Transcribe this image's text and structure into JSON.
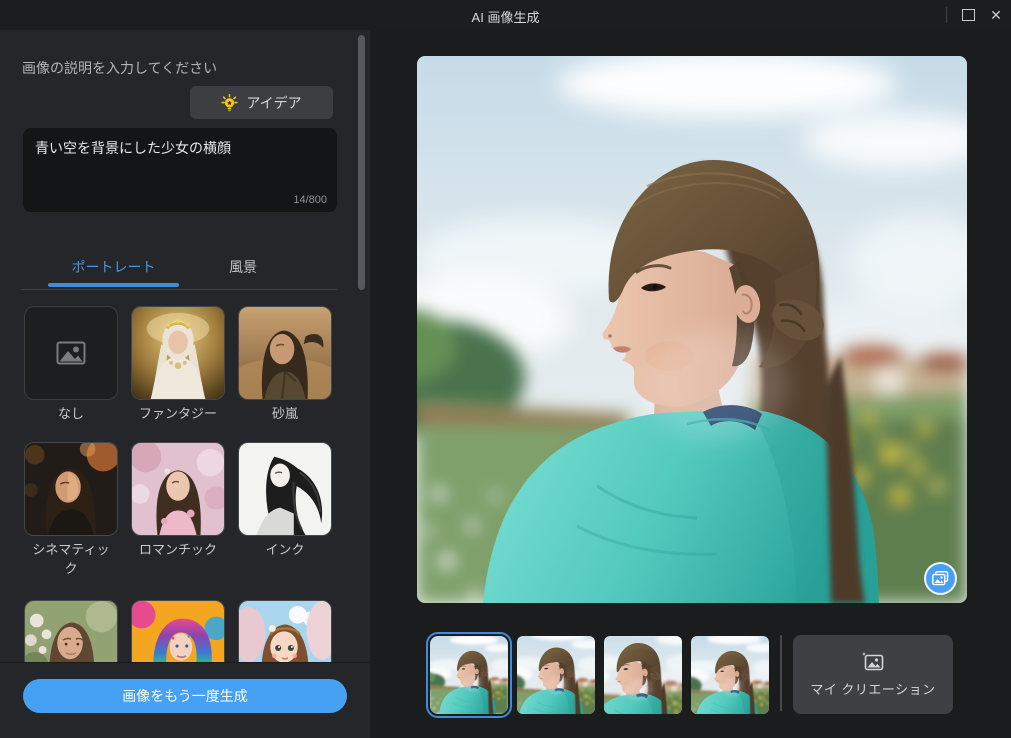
{
  "window": {
    "title": "AI 画像生成",
    "close_glyph": "✕"
  },
  "prompt": {
    "label": "画像の説明を入力してください",
    "idea_button_label": "アイデア",
    "value": "青い空を背景にした少女の横顔",
    "char_counter": "14/800"
  },
  "tabs": {
    "portrait": "ポートレート",
    "landscape": "風景",
    "active_tab": "portrait"
  },
  "styles": [
    {
      "label": "なし"
    },
    {
      "label": "ファンタジー"
    },
    {
      "label": "砂嵐"
    },
    {
      "label": "シネマティック"
    },
    {
      "label": "ロマンチック"
    },
    {
      "label": "インク"
    },
    {
      "label": ""
    },
    {
      "label": ""
    },
    {
      "label": ""
    }
  ],
  "generate_button_label": "画像をもう一度生成",
  "results": {
    "count": 4,
    "selected_index": 0,
    "my_creations_label": "マイ クリエーション"
  },
  "icons": {
    "idea": "lightbulb-icon",
    "none_style": "image-placeholder-icon",
    "gallery": "photos-icon",
    "my_creations": "image-icon",
    "maximize": "maximize-icon",
    "close": "close-icon"
  },
  "colors": {
    "accent_blue": "#46a1f4",
    "tab_active_blue": "#4796e3",
    "selection_blue": "#3e8ddd",
    "panel_bg": "#242629",
    "canvas_bg": "#1a1c1e"
  }
}
